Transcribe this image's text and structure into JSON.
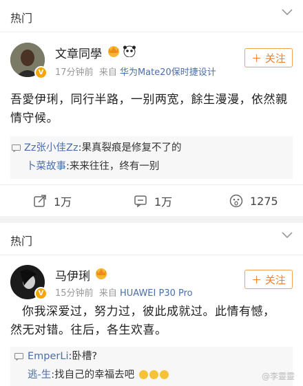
{
  "posts": [
    {
      "section": "热门",
      "user": "文章同學",
      "time": "17分钟前",
      "from_label": "来自",
      "source": "华为Mate20保时捷设计",
      "follow_label": "关注",
      "text_line1": "吾愛伊琍，同行半路，一别两宽，餘生漫漫，依然親",
      "text_line2": "情守候。",
      "comments": [
        {
          "user": "Zz张小佳Zz",
          "text": ":果真裂痕是修复不了的"
        },
        {
          "user": "卜菜故事",
          "text": ":来来往往，终有一别"
        }
      ],
      "actions": {
        "repost": "1万",
        "comment": "1万",
        "like": "1275"
      }
    },
    {
      "section": "热门",
      "user": "马伊琍",
      "time": "15分钟前",
      "from_label": "来自",
      "source": "HUAWEI P30 Pro",
      "follow_label": "关注",
      "text_line1": "你我深爱过，努力过，彼此成就过。此情有憾，",
      "text_line2": "然无对错。往后，各生欢喜。",
      "comments": [
        {
          "user": "EmperLi",
          "text": ":卧槽?"
        },
        {
          "user": "逃-生",
          "text": ":找自己的幸福去吧"
        }
      ]
    }
  ],
  "watermark": "@李靈靈",
  "colors": {
    "accent": "#f07f2b",
    "link": "#4a6ea9",
    "badge": "#f7a60a"
  }
}
